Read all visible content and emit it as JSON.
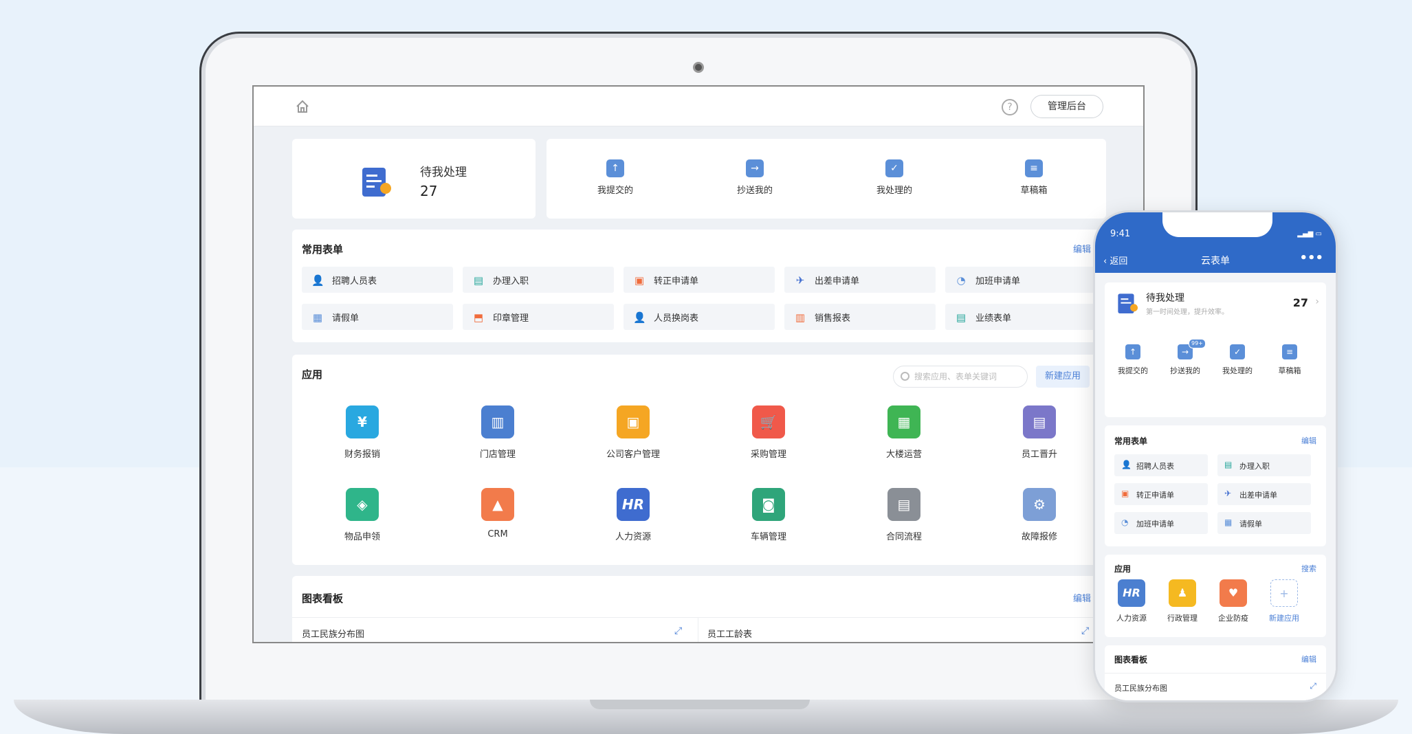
{
  "desktop": {
    "admin_button": "管理后台",
    "help_glyph": "?",
    "pending": {
      "title": "待我处理",
      "count": "27"
    },
    "quick": [
      {
        "label": "我提交的",
        "glyph": "↑"
      },
      {
        "label": "抄送我的",
        "glyph": "→"
      },
      {
        "label": "我处理的",
        "glyph": "✓"
      },
      {
        "label": "草稿箱",
        "glyph": "≡"
      }
    ],
    "forms": {
      "title": "常用表单",
      "edit": "编辑",
      "items": [
        {
          "label": "招聘人员表",
          "glyph": "👤",
          "color": "#4caf50"
        },
        {
          "label": "办理入职",
          "glyph": "▤",
          "color": "#26a69a"
        },
        {
          "label": "转正申请单",
          "glyph": "▣",
          "color": "#f06c3c"
        },
        {
          "label": "出差申请单",
          "glyph": "✈",
          "color": "#3f6ccf"
        },
        {
          "label": "加班申请单",
          "glyph": "◔",
          "color": "#5b8fd8"
        },
        {
          "label": "请假单",
          "glyph": "▦",
          "color": "#5b8fd8"
        },
        {
          "label": "印章管理",
          "glyph": "⬒",
          "color": "#f06c3c"
        },
        {
          "label": "人员换岗表",
          "glyph": "👤",
          "color": "#4caf50"
        },
        {
          "label": "销售报表",
          "glyph": "▥",
          "color": "#f06c3c"
        },
        {
          "label": "业绩表单",
          "glyph": "▤",
          "color": "#26a69a"
        }
      ]
    },
    "apps": {
      "title": "应用",
      "search_placeholder": "搜索应用、表单关键词",
      "new_app": "新建应用",
      "items": [
        {
          "label": "财务报销",
          "glyph": "¥",
          "color": "#29a8e0"
        },
        {
          "label": "门店管理",
          "glyph": "▥",
          "color": "#4b7fd0"
        },
        {
          "label": "公司客户管理",
          "glyph": "▣",
          "color": "#f5a623"
        },
        {
          "label": "采购管理",
          "glyph": "🛒",
          "color": "#f0594a"
        },
        {
          "label": "大楼运营",
          "glyph": "▦",
          "color": "#3fb554"
        },
        {
          "label": "员工晋升",
          "glyph": "▤",
          "color": "#7b77c9"
        },
        {
          "label": "物品申领",
          "glyph": "◈",
          "color": "#2fb58a"
        },
        {
          "label": "CRM",
          "glyph": "▲",
          "color": "#f27b4b"
        },
        {
          "label": "人力资源",
          "glyph": "HR",
          "color": "#3f6ccf"
        },
        {
          "label": "车辆管理",
          "glyph": "◙",
          "color": "#2fa57a"
        },
        {
          "label": "合同流程",
          "glyph": "▤",
          "color": "#8a8f96"
        },
        {
          "label": "故障报修",
          "glyph": "⚙",
          "color": "#7d9fd6"
        }
      ]
    },
    "dashboard": {
      "title": "图表看板",
      "edit": "编辑",
      "panels": [
        "员工民族分布图",
        "员工工龄表"
      ],
      "expand_glyph": "⤢"
    }
  },
  "phone": {
    "time": "9:41",
    "status": "▂▄▆ ▭",
    "back": "‹ 返回",
    "title": "云表单",
    "more": "•••",
    "pending": {
      "title": "待我处理",
      "subtitle": "第一时间处理，提升效率。",
      "count": "27",
      "chevron": "›"
    },
    "quick": [
      {
        "label": "我提交的",
        "glyph": "↑"
      },
      {
        "label": "抄送我的",
        "glyph": "→",
        "badge": "99+"
      },
      {
        "label": "我处理的",
        "glyph": "✓"
      },
      {
        "label": "草稿箱",
        "glyph": "≡"
      }
    ],
    "forms": {
      "title": "常用表单",
      "edit": "编辑",
      "items": [
        {
          "label": "招聘人员表",
          "glyph": "👤",
          "color": "#4caf50"
        },
        {
          "label": "办理入职",
          "glyph": "▤",
          "color": "#26a69a"
        },
        {
          "label": "转正申请单",
          "glyph": "▣",
          "color": "#f06c3c"
        },
        {
          "label": "出差申请单",
          "glyph": "✈",
          "color": "#3f6ccf"
        },
        {
          "label": "加班申请单",
          "glyph": "◔",
          "color": "#5b8fd8"
        },
        {
          "label": "请假单",
          "glyph": "▦",
          "color": "#5b8fd8"
        }
      ]
    },
    "apps": {
      "title": "应用",
      "search": "搜索",
      "items": [
        {
          "label": "人力资源",
          "glyph": "HR",
          "color": "#4b7fd0"
        },
        {
          "label": "行政管理",
          "glyph": "♟",
          "color": "#f5b921"
        },
        {
          "label": "企业防疫",
          "glyph": "♥",
          "color": "#f27b4b"
        },
        {
          "label": "新建应用",
          "glyph": "+",
          "color": "#ffffff"
        }
      ]
    },
    "dashboard": {
      "title": "图表看板",
      "edit": "编辑",
      "panel": "员工民族分布图",
      "expand_glyph": "⤢"
    }
  }
}
